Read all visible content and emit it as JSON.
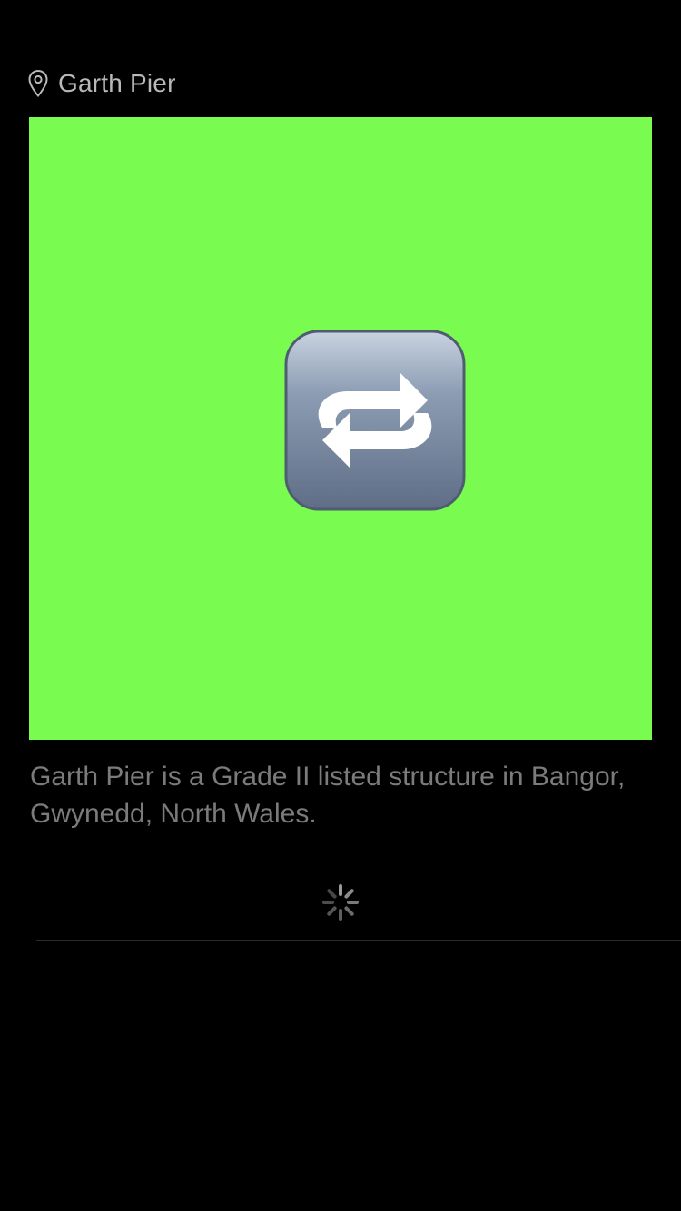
{
  "location": {
    "name": "Garth Pier",
    "icon": "location-pin-icon"
  },
  "media": {
    "background_color": "#79fb4f",
    "icon": "repeat-icon"
  },
  "description": "Garth Pier is a Grade II listed structure in Bangor, Gwynedd, North Wales.",
  "loading": {
    "icon": "activity-spinner-icon"
  }
}
